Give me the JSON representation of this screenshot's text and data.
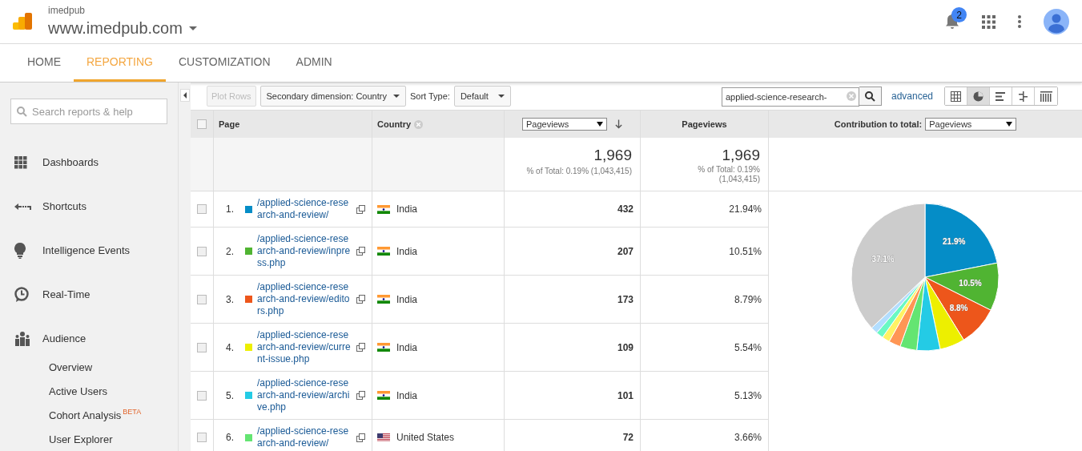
{
  "header": {
    "account": "imedpub",
    "property": "www.imedpub.com",
    "notifications": "2"
  },
  "nav_tabs": [
    {
      "label": "HOME",
      "selected": false
    },
    {
      "label": "REPORTING",
      "selected": true
    },
    {
      "label": "CUSTOMIZATION",
      "selected": false
    },
    {
      "label": "ADMIN",
      "selected": false
    }
  ],
  "sidebar": {
    "search": {
      "placeholder": "Search reports & help"
    },
    "items": [
      {
        "kind": "dashboards",
        "label": "Dashboards"
      },
      {
        "kind": "shortcuts",
        "label": "Shortcuts"
      },
      {
        "kind": "intelligence",
        "label": "Intelligence Events"
      },
      {
        "kind": "realtime",
        "label": "Real-Time"
      },
      {
        "kind": "audience",
        "label": "Audience",
        "children": [
          {
            "label": "Overview"
          },
          {
            "label": "Active Users"
          },
          {
            "label": "Cohort Analysis",
            "badge": "BETA"
          },
          {
            "label": "User Explorer"
          }
        ]
      }
    ]
  },
  "toolbar": {
    "plot_rows": {
      "label": "Plot Rows",
      "disabled": true
    },
    "secondary_dimension": "Secondary dimension: Country",
    "sort_type_label": "Sort Type:",
    "sort_type": "Default",
    "filter": {
      "value": "applied-science-research-"
    },
    "advanced": "advanced",
    "views": [
      {
        "kind": "table",
        "selected": false
      },
      {
        "kind": "pie",
        "selected": true
      },
      {
        "kind": "bar",
        "selected": false
      },
      {
        "kind": "comparison",
        "selected": false
      },
      {
        "kind": "pivot",
        "selected": false
      }
    ]
  },
  "table": {
    "select_all": {
      "checked": false
    },
    "columns": {
      "page": "Page",
      "country": "Country",
      "metric_select": "Pageviews",
      "metric": "Pageviews",
      "contribution_label": "Contribution to total:",
      "contribution_select": "Pageviews"
    },
    "summary": {
      "total": "1,969",
      "percent": "% of Total: 0.19% (1,043,415)",
      "total_2": "1,969",
      "percent_2": "% of Total: 0.19% (1,043,415)"
    },
    "rows": [
      {
        "index": "1.",
        "color": "#058dc7",
        "page": "/applied-science-research-and-review/",
        "country": "India",
        "kind": "india",
        "pageviews": "432",
        "percent": "21.94%",
        "checked": false
      },
      {
        "index": "2.",
        "color": "#50b432",
        "page": "/applied-science-research-and-review/inpress.php",
        "country": "India",
        "kind": "india",
        "pageviews": "207",
        "percent": "10.51%",
        "checked": false
      },
      {
        "index": "3.",
        "color": "#ed561b",
        "page": "/applied-science-research-and-review/editors.php",
        "country": "India",
        "kind": "india",
        "pageviews": "173",
        "percent": "8.79%",
        "checked": false
      },
      {
        "index": "4.",
        "color": "#edef00",
        "page": "/applied-science-research-and-review/current-issue.php",
        "country": "India",
        "kind": "india",
        "pageviews": "109",
        "percent": "5.54%",
        "checked": false
      },
      {
        "index": "5.",
        "color": "#24cbe5",
        "page": "/applied-science-research-and-review/archive.php",
        "country": "India",
        "kind": "india",
        "pageviews": "101",
        "percent": "5.13%",
        "checked": false
      },
      {
        "index": "6.",
        "color": "#64e572",
        "page": "/applied-science-research-and-review/",
        "country": "United States",
        "kind": "us",
        "pageviews": "72",
        "percent": "3.66%",
        "checked": false
      }
    ],
    "chart_data": {
      "type": "pie",
      "series": [
        {
          "values": [
            21.9,
            10.5,
            8.8,
            5.5,
            5.1,
            3.7,
            2.6,
            1.7,
            1.6,
            1.5,
            37.1
          ]
        }
      ],
      "colors": [
        "#058dc7",
        "#50b432",
        "#ed561b",
        "#edef00",
        "#24cbe5",
        "#64e572",
        "#ff9655",
        "#fff263",
        "#6af9c4",
        "#b2deff",
        "#cccccc"
      ],
      "value_labels": [
        "21.9%",
        "10.5%",
        "8.8%",
        null,
        null,
        null,
        null,
        null,
        null,
        null,
        "37.1%"
      ]
    }
  }
}
